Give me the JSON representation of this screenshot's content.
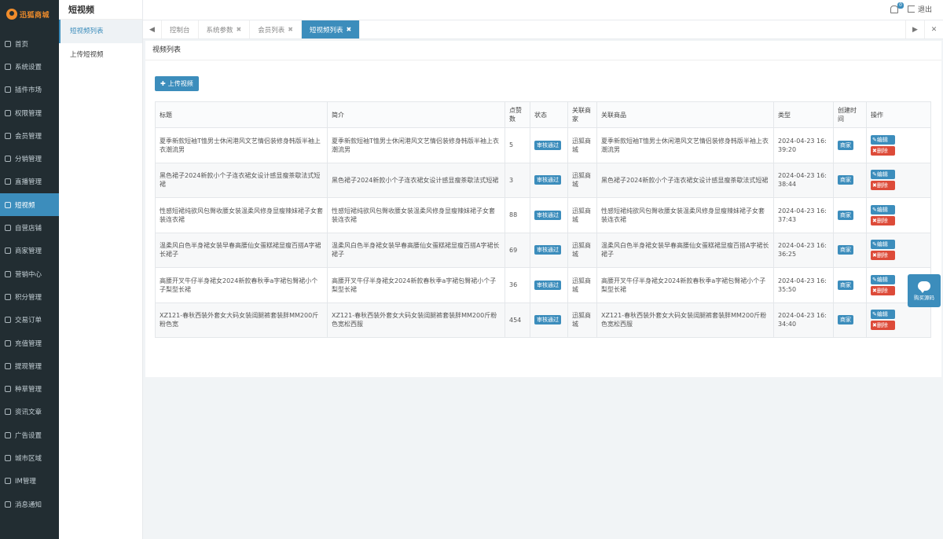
{
  "brand": {
    "logo_text": "迅狐商城",
    "accent": "#3c8dbc",
    "sidebar_bg": "#222d32",
    "brand_color": "#f08c2b"
  },
  "sidebar": {
    "items": [
      {
        "label": "首页",
        "icon": "home-icon"
      },
      {
        "label": "系统设置",
        "icon": "gear-icon"
      },
      {
        "label": "插件市场",
        "icon": "plug-icon"
      },
      {
        "label": "权限管理",
        "icon": "bars-icon"
      },
      {
        "label": "会员管理",
        "icon": "users-icon"
      },
      {
        "label": "分销管理",
        "icon": "share-icon"
      },
      {
        "label": "直播管理",
        "icon": "video-icon"
      },
      {
        "label": "短视频",
        "icon": "file-video-icon",
        "active": true
      },
      {
        "label": "自营店铺",
        "icon": "shop-icon"
      },
      {
        "label": "商家管理",
        "icon": "store-icon"
      },
      {
        "label": "营销中心",
        "icon": "target-icon"
      },
      {
        "label": "积分管理",
        "icon": "points-icon"
      },
      {
        "label": "交易订单",
        "icon": "yen-icon"
      },
      {
        "label": "充值管理",
        "icon": "wallet-icon"
      },
      {
        "label": "提现管理",
        "icon": "withdraw-icon"
      },
      {
        "label": "种草管理",
        "icon": "leaf-icon"
      },
      {
        "label": "资讯文章",
        "icon": "news-icon"
      },
      {
        "label": "广告设置",
        "icon": "image-icon"
      },
      {
        "label": "城市区域",
        "icon": "map-icon"
      },
      {
        "label": "IM管理",
        "icon": "chat-icon"
      },
      {
        "label": "消息通知",
        "icon": "message-icon"
      }
    ]
  },
  "subnav": {
    "title": "短视频",
    "items": [
      {
        "label": "短视频列表",
        "active": true
      },
      {
        "label": "上传短视频",
        "active": false
      }
    ]
  },
  "header": {
    "badge": "0",
    "logout_label": "退出"
  },
  "tabs": [
    {
      "label": "控制台",
      "closable": false
    },
    {
      "label": "系统参数",
      "closable": true
    },
    {
      "label": "会员列表",
      "closable": true
    },
    {
      "label": "短视频列表",
      "closable": true,
      "active": true
    }
  ],
  "panel": {
    "title": "视频列表",
    "upload_button": "上传视频"
  },
  "table": {
    "headers": [
      "标题",
      "简介",
      "点赞数",
      "状态",
      "关联商家",
      "关联商品",
      "类型",
      "创建时间",
      "操作"
    ],
    "rows": [
      {
        "title": "夏季新款短袖T恤男士休闲港风文艺情侣装修身韩版半袖上衣潮流男",
        "intro": "夏季新款短袖T恤男士休闲港风文艺情侣装修身韩版半袖上衣潮流男",
        "likes": "5",
        "status": "审核通过",
        "merchant": "迅狐商城",
        "product": "夏季新款短袖T恤男士休闲港风文艺情侣装修身韩版半袖上衣潮流男",
        "type": "2024-04-23 16:39:20",
        "created": "商家",
        "edit": "编辑",
        "delete": "删除"
      },
      {
        "title": "黑色裙子2024新款小个子连衣裙女设计感显瘦茶歇法式短裙",
        "intro": "黑色裙子2024新款小个子连衣裙女设计感显瘦茶歇法式短裙",
        "likes": "3",
        "status": "审核通过",
        "merchant": "迅狐商城",
        "product": "黑色裙子2024新款小个子连衣裙女设计感显瘦茶歇法式短裙",
        "type": "2024-04-23 16:38:44",
        "created": "商家",
        "edit": "编辑",
        "delete": "删除"
      },
      {
        "title": "性感短裙纯欲风包臀收腰女装温柔风修身显瘦辣妹裙子女套装连衣裙",
        "intro": "性感短裙纯欲风包臀收腰女装温柔风修身显瘦辣妹裙子女套装连衣裙",
        "likes": "88",
        "status": "审核通过",
        "merchant": "迅狐商城",
        "product": "性感短裙纯欲风包臀收腰女装温柔风修身显瘦辣妹裙子女套装连衣裙",
        "type": "2024-04-23 16:37:43",
        "created": "商家",
        "edit": "编辑",
        "delete": "删除"
      },
      {
        "title": "温柔风白色半身裙女装早春高腰仙女蛋糕裙显瘦百搭A字裙长裙子",
        "intro": "温柔风白色半身裙女装早春高腰仙女蛋糕裙显瘦百搭A字裙长裙子",
        "likes": "69",
        "status": "审核通过",
        "merchant": "迅狐商城",
        "product": "温柔风白色半身裙女装早春高腰仙女蛋糕裙显瘦百搭A字裙长裙子",
        "type": "2024-04-23 16:36:25",
        "created": "商家",
        "edit": "编辑",
        "delete": "删除"
      },
      {
        "title": "高腰开叉牛仔半身裙女2024新款春秋季a字裙包臀裙小个子梨型长裙",
        "intro": "高腰开叉牛仔半身裙女2024新款春秋季a字裙包臀裙小个子梨型长裙",
        "likes": "36",
        "status": "审核通过",
        "merchant": "迅狐商城",
        "product": "高腰开叉牛仔半身裙女2024新款春秋季a字裙包臀裙小个子梨型长裙",
        "type": "2024-04-23 16:35:50",
        "created": "商家",
        "edit": "编辑",
        "delete": "删除"
      },
      {
        "title": "XZ121-春秋西装外套女大码女装阔腿裤套装胖MM200斤粉色宽",
        "intro": "XZ121-春秋西装外套女大码女装阔腿裤套装胖MM200斤粉色宽松西服",
        "likes": "454",
        "status": "审核通过",
        "merchant": "迅狐商城",
        "product": "XZ121-春秋西装外套女大码女装阔腿裤套装胖MM200斤粉色宽松西服",
        "type": "2024-04-23 16:34:40",
        "created": "商家",
        "edit": "编辑",
        "delete": "删除"
      }
    ]
  },
  "chat_widget": {
    "label": "购买源码"
  }
}
